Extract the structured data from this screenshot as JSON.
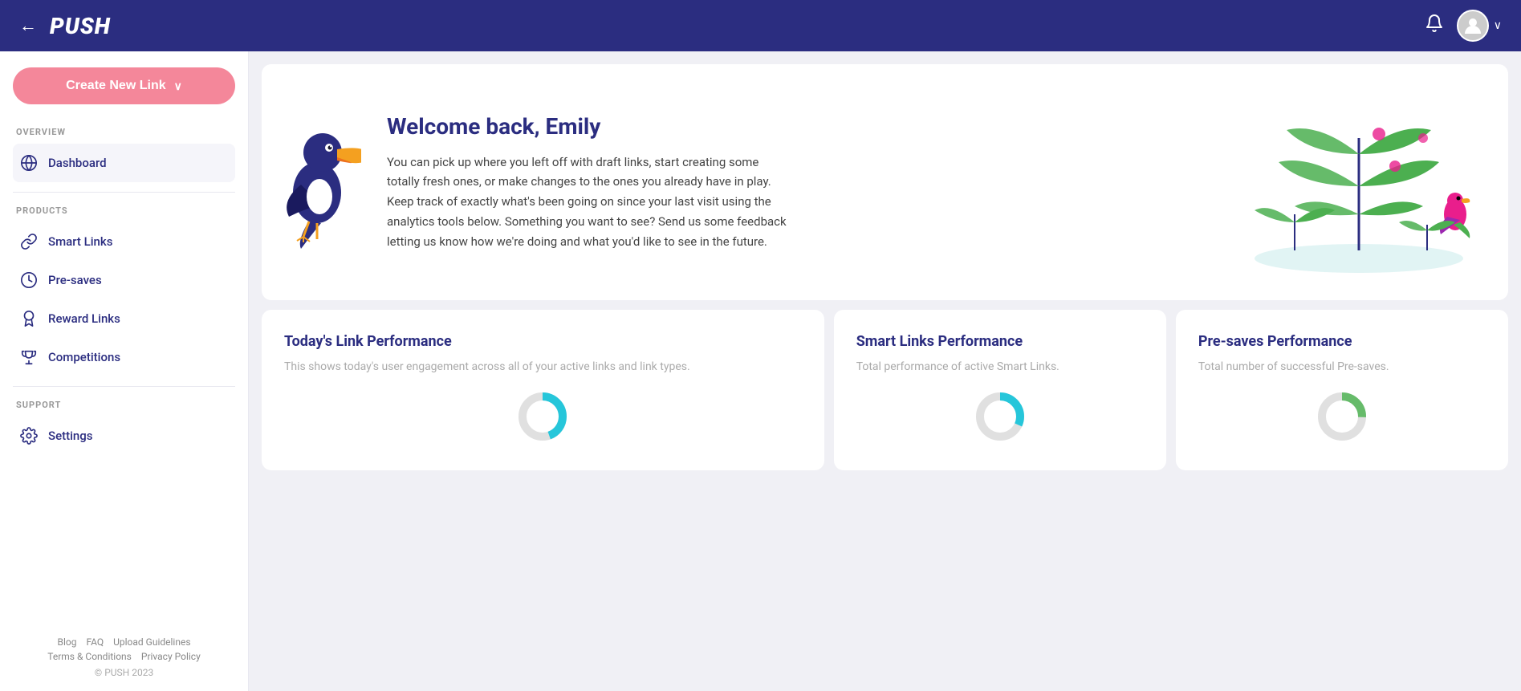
{
  "topNav": {
    "backLabel": "←",
    "logo": "PUSH",
    "avatarAlt": "user avatar",
    "chevron": "∨"
  },
  "sidebar": {
    "createButton": "Create New Link",
    "createChevron": "∨",
    "sections": [
      {
        "label": "OVERVIEW",
        "items": [
          {
            "id": "dashboard",
            "label": "Dashboard",
            "icon": "globe"
          }
        ]
      },
      {
        "label": "PRODUCTS",
        "items": [
          {
            "id": "smart-links",
            "label": "Smart Links",
            "icon": "link"
          },
          {
            "id": "pre-saves",
            "label": "Pre-saves",
            "icon": "circle-clock"
          },
          {
            "id": "reward-links",
            "label": "Reward Links",
            "icon": "badge"
          },
          {
            "id": "competitions",
            "label": "Competitions",
            "icon": "trophy"
          }
        ]
      },
      {
        "label": "SUPPORT",
        "items": [
          {
            "id": "settings",
            "label": "Settings",
            "icon": "gear"
          }
        ]
      }
    ],
    "footerLinks": [
      "Blog",
      "FAQ",
      "Upload Guidelines",
      "Terms & Conditions",
      "Privacy Policy"
    ],
    "copyright": "© PUSH 2023"
  },
  "welcome": {
    "title": "Welcome back, Emily",
    "text": "You can pick up where you left off with draft links, start creating some totally fresh ones, or make changes to the ones you already have in play. Keep track of exactly what's been going on since your last visit using the analytics tools below. Something you want to see? Send us some feedback letting us know how we're doing and what you'd like to see in the future."
  },
  "cards": [
    {
      "id": "todays-performance",
      "title": "Today's Link Performance",
      "subtitle": "This shows today's user engagement across all of your active links and link types.",
      "large": true
    },
    {
      "id": "smart-links-performance",
      "title": "Smart Links Performance",
      "subtitle": "Total performance of active Smart Links."
    },
    {
      "id": "pre-saves-performance",
      "title": "Pre-saves Performance",
      "subtitle": "Total number of successful Pre-saves."
    }
  ]
}
